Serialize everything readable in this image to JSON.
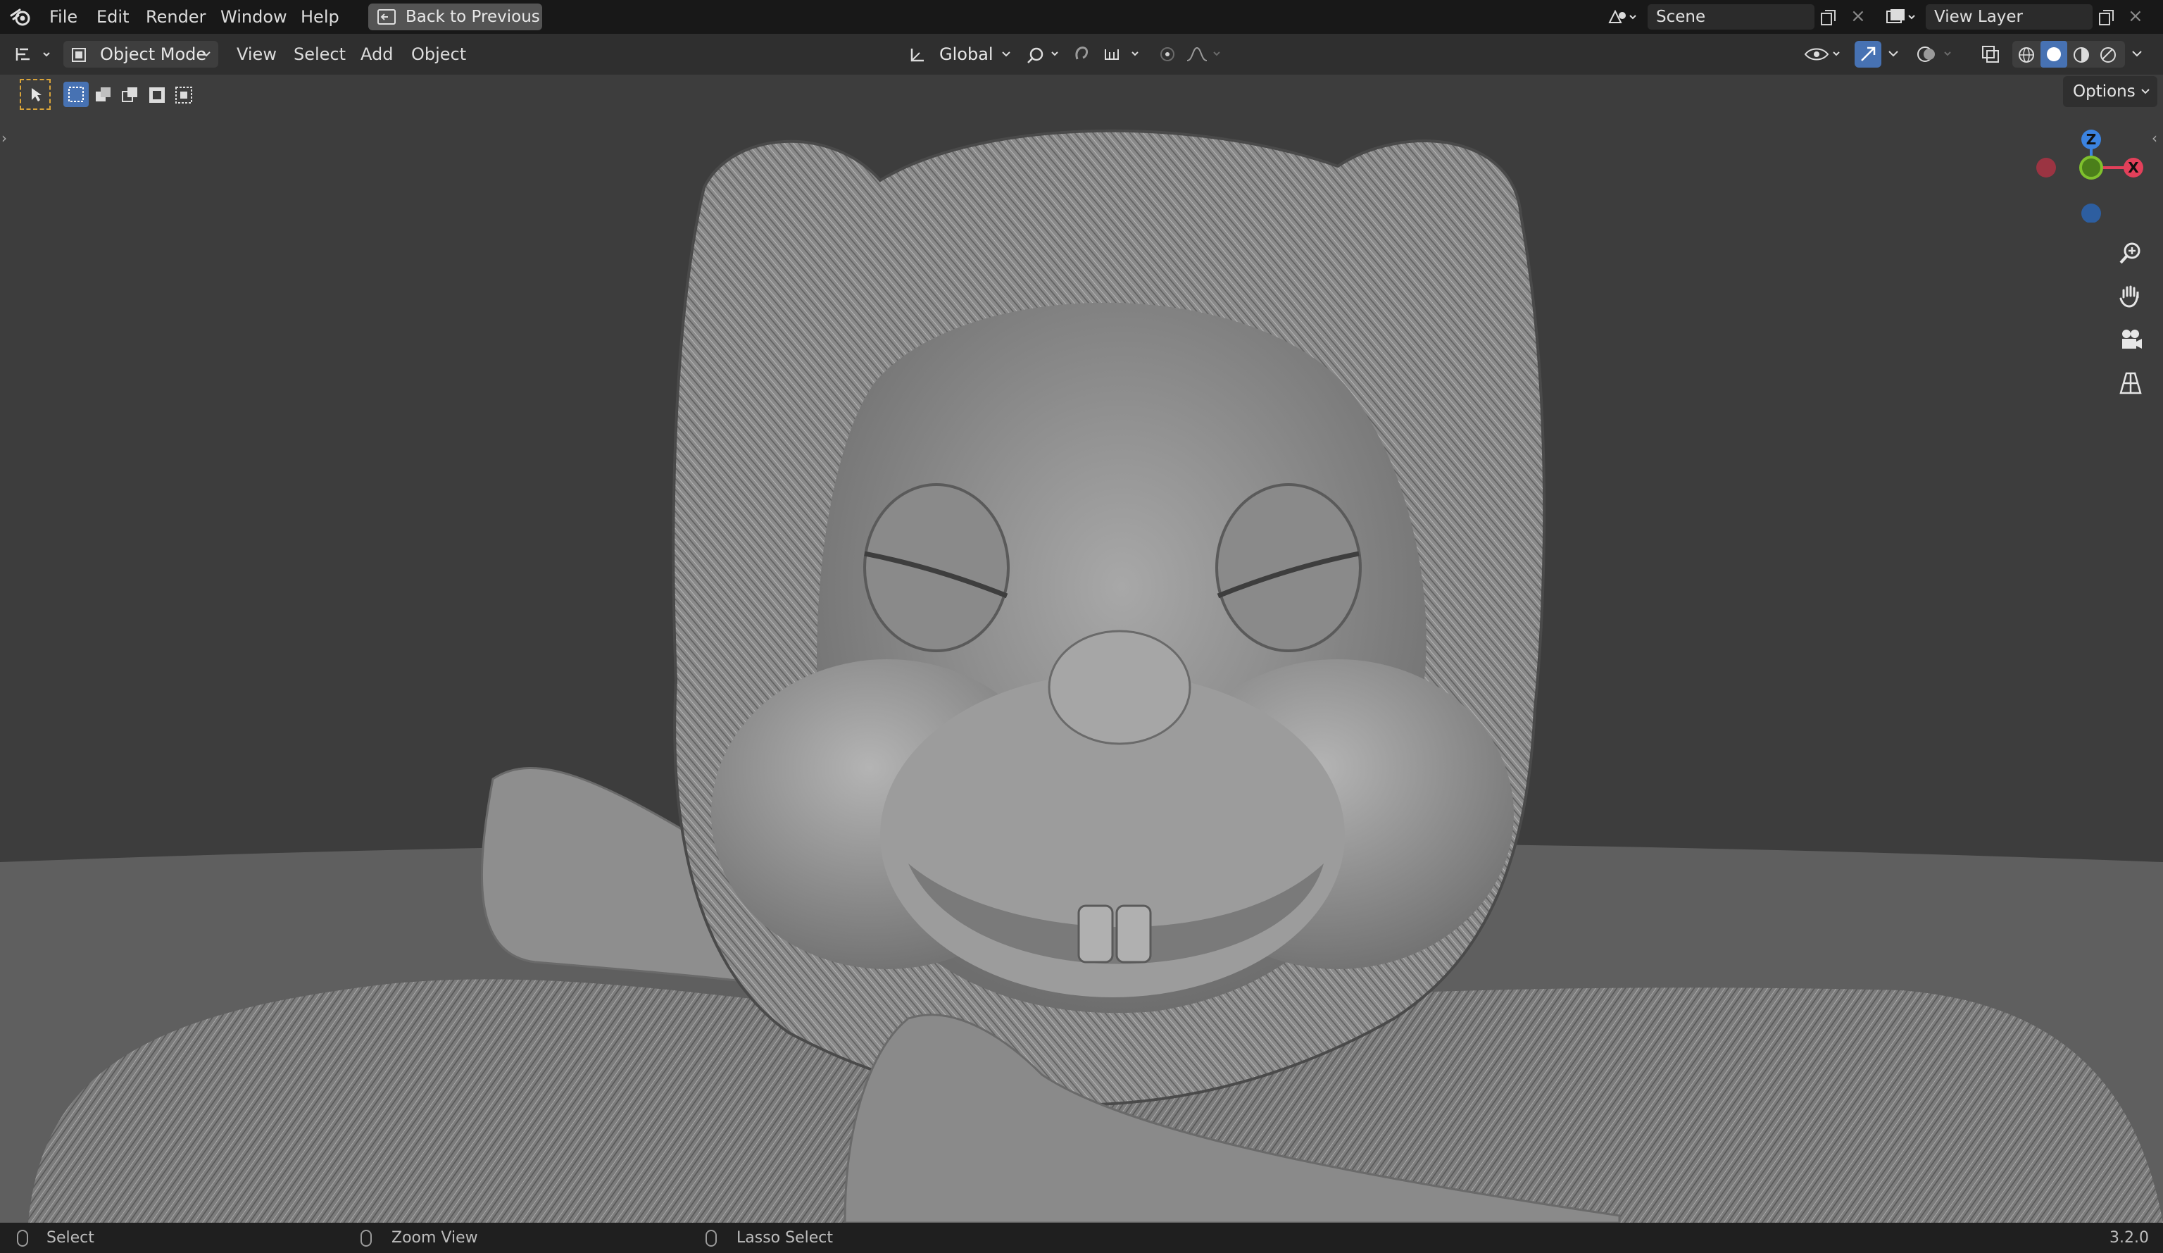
{
  "topbar": {
    "menus": [
      "File",
      "Edit",
      "Render",
      "Window",
      "Help"
    ],
    "back_button": "Back to Previous",
    "scene_name": "Scene",
    "view_layer": "View Layer"
  },
  "header": {
    "mode": "Object Mode",
    "menus": [
      "View",
      "Select",
      "Add",
      "Object"
    ],
    "orientation": "Global",
    "options": "Options"
  },
  "gizmo": {
    "z": "Z",
    "x": "X"
  },
  "statusbar": {
    "select": "Select",
    "zoom": "Zoom View",
    "lasso": "Lasso Select",
    "version": "3.2.0"
  },
  "colors": {
    "accent_blue": "#4772b3",
    "axis_x": "#e3405a",
    "axis_y": "#7fc12d",
    "axis_z": "#3b83e0"
  },
  "icons": [
    "blender-logo-icon",
    "back-icon",
    "scene-icon",
    "copy-icon",
    "close-icon",
    "layer-icon",
    "editor-type-icon",
    "object-mode-icon",
    "transform-orientation-icon",
    "pivot-icon",
    "snap-icon",
    "proportional-icon",
    "visibility-icon",
    "gizmo-icon",
    "overlay-icon",
    "xray-icon",
    "shading-wireframe-icon",
    "shading-solid-icon",
    "shading-material-icon",
    "shading-rendered-icon",
    "select-tool-icon",
    "zoom-icon",
    "hand-icon",
    "camera-icon",
    "grid-icon",
    "mouse-icon"
  ]
}
